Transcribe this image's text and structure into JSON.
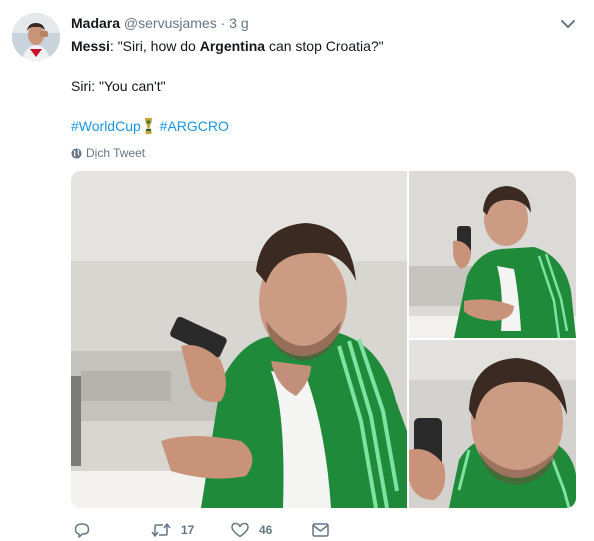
{
  "tweet": {
    "author_name": "Madara",
    "author_handle": "@servusjames",
    "separator": "·",
    "time": "3 g",
    "text": {
      "line1_speaker": "Messi",
      "line1_pre": ": \"Siri, how do ",
      "line1_bold": "Argentina",
      "line1_post": " can stop Croatia?\"",
      "line2": "Siri: \"You can't\"",
      "hashtag1": "#WorldCup",
      "hashtag2": "#ARGCRO"
    },
    "translate_label": "Dịch Tweet",
    "actions": {
      "retweet_count": "17",
      "like_count": "46"
    }
  },
  "colors": {
    "link": "#1b95e0",
    "secondary_text": "#657786",
    "jacket_green": "#1f8a3a",
    "stripe_green": "#7fe2a0"
  },
  "icons": [
    "globe-icon",
    "chevron-down-icon",
    "trophy-icon",
    "reply-icon",
    "retweet-icon",
    "heart-icon",
    "envelope-icon"
  ]
}
